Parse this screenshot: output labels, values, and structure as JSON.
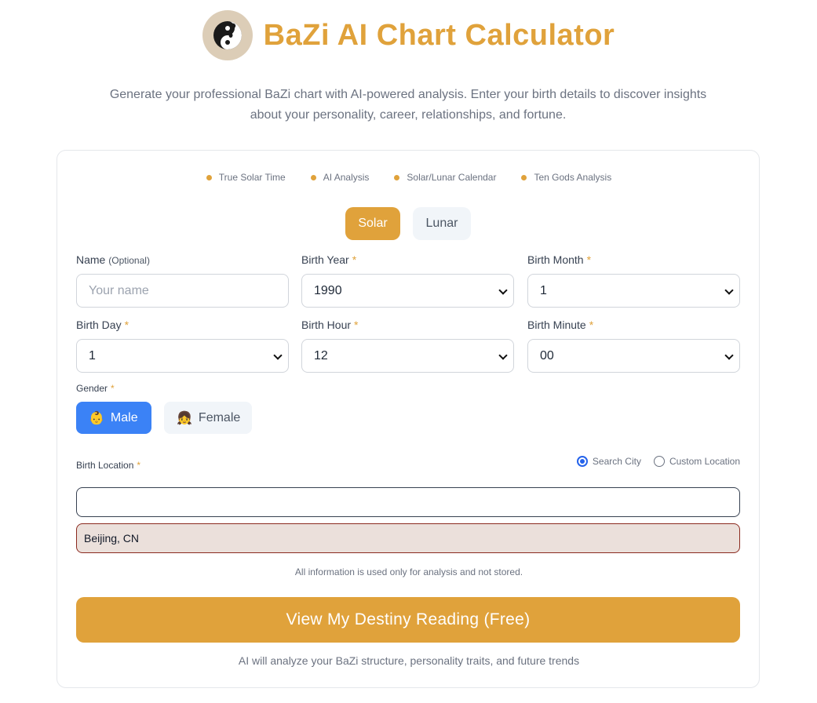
{
  "header": {
    "title": "BaZi AI Chart Calculator",
    "logo_icon": "yin-yang-panda-icon",
    "subtitle": "Generate your professional BaZi chart with AI-powered analysis. Enter your birth details to discover insights about your personality, career, relationships, and fortune."
  },
  "features": [
    "True Solar Time",
    "AI Analysis",
    "Solar/Lunar Calendar",
    "Ten Gods Analysis"
  ],
  "calendar": {
    "solar_label": "Solar",
    "lunar_label": "Lunar",
    "selected": "Solar"
  },
  "form": {
    "name": {
      "label": "Name",
      "optional": "(Optional)",
      "placeholder": "Your name"
    },
    "birth_year": {
      "label": "Birth Year",
      "value": "1990"
    },
    "birth_month": {
      "label": "Birth Month",
      "value": "1"
    },
    "birth_day": {
      "label": "Birth Day",
      "value": "1"
    },
    "birth_hour": {
      "label": "Birth Hour",
      "value": "12"
    },
    "birth_minute": {
      "label": "Birth Minute",
      "value": "00"
    },
    "required_mark": "*"
  },
  "gender": {
    "label": "Gender",
    "male": {
      "label": "Male",
      "icon": "👶"
    },
    "female": {
      "label": "Female",
      "icon": "👧"
    },
    "selected": "Male"
  },
  "location": {
    "label": "Birth Location",
    "mode_search": "Search City",
    "mode_custom": "Custom Location",
    "selected_mode": "Search City",
    "search_value": "",
    "result": "Beijing, CN"
  },
  "privacy_note": "All information is used only for analysis and not stored.",
  "cta": {
    "label": "View My Destiny Reading (Free)"
  },
  "footnote": "AI will analyze your BaZi structure, personality traits, and future trends",
  "colors": {
    "accent": "#e0a23b",
    "male_selected": "#3b82f6",
    "radio": "#2563eb"
  }
}
